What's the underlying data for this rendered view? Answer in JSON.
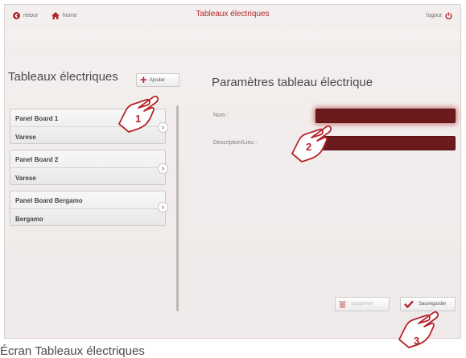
{
  "header": {
    "back_label": "retour",
    "home_label": "home",
    "title": "Tableaux électriques",
    "logout_label": "logout"
  },
  "left": {
    "title": "Tableaux électriques",
    "add_label": "Ajouter",
    "panels": [
      {
        "name": "Panel Board 1",
        "place": "Varese"
      },
      {
        "name": "Panel Board 2",
        "place": "Varese"
      },
      {
        "name": "Panel Board Bergamo",
        "place": "Bergamo"
      }
    ]
  },
  "right": {
    "title": "Paramètres tableau électrique",
    "name_label": "Nom :",
    "name_value": "",
    "desc_label": "Description/Lieu :",
    "desc_value": "",
    "delete_label": "Supprimer",
    "save_label": "Sauvegarder"
  },
  "callouts": [
    "1",
    "2",
    "3"
  ],
  "bottom_caption": "Écran Tableaux électriques",
  "colors": {
    "accent": "#b5252a",
    "field_bg": "#6b1a1e"
  }
}
